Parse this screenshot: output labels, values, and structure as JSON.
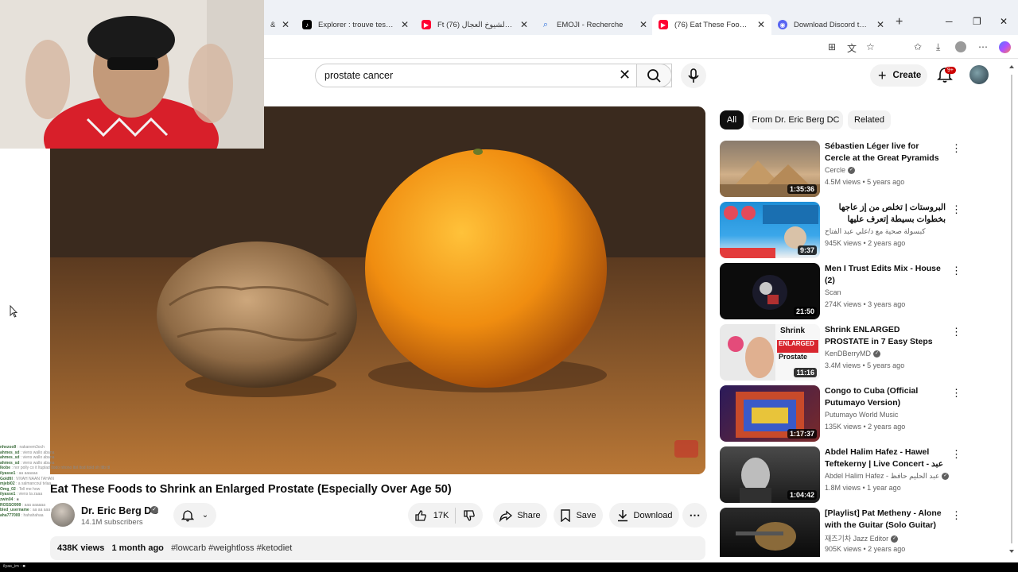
{
  "browser": {
    "tabs": [
      {
        "title": "& Sp",
        "icon": "partial-tab-icon",
        "color": "#888888"
      },
      {
        "title": "Explorer : trouve tes vidéo",
        "icon": "tiktok-icon",
        "color": "#000000"
      },
      {
        "title": "Ft شرح الشيوخ العجال (76)",
        "icon": "youtube-icon",
        "color": "#ff0033"
      },
      {
        "title": "EMOJI - Recherche",
        "icon": "search-icon",
        "color": "#2a6fdb"
      },
      {
        "title": "(76) Eat These Foods to Sh",
        "icon": "youtube-icon",
        "color": "#ff0033"
      },
      {
        "title": "Download Discord to Talk",
        "icon": "discord-icon",
        "color": "#5865f2"
      }
    ],
    "new_tab": "+"
  },
  "header": {
    "search_value": "prostate cancer",
    "create_label": "Create",
    "notifications_count": "9+"
  },
  "video": {
    "title": "Eat These Foods to Shrink an Enlarged Prostate (Especially Over Age 50)",
    "channel": "Dr. Eric Berg DC",
    "subscribers": "14.1M subscribers",
    "likes": "17K",
    "share_label": "Share",
    "save_label": "Save",
    "download_label": "Download",
    "views": "438K views",
    "uploaded": "1 month ago",
    "tags": "#lowcarb #weightloss #ketodiet"
  },
  "chips": [
    "All",
    "From Dr. Eric Berg DC",
    "Related"
  ],
  "recommendations": [
    {
      "title": "Sébastien Léger live for Cercle at the Great Pyramids of Giza, ...",
      "channel": "Cercle",
      "verified": true,
      "meta": "4.5M views • 5 years ago",
      "duration": "1:35:36",
      "thumb": "pyramids"
    },
    {
      "title": "البروستات | تخلص من إز عاجها بخطوات بسيطة إتعرف عليها #prostatitis#",
      "channel": "كبسولة صحية مع د/علي عبد الفتاح",
      "verified": false,
      "meta": "945K views • 2 years ago",
      "duration": "9:37",
      "thumb": "arabic"
    },
    {
      "title": "Men I Trust Edits Mix - House (2)",
      "channel": "Scan",
      "verified": false,
      "meta": "274K views • 3 years ago",
      "duration": "21:50",
      "thumb": "dark"
    },
    {
      "title": "Shrink ENLARGED PROSTATE in 7 Easy Steps (2024 Update)",
      "channel": "KenDBerryMD",
      "verified": true,
      "meta": "3.4M views • 5 years ago",
      "duration": "11:16",
      "thumb": "shrink"
    },
    {
      "title": "Congo to Cuba (Official Putumayo Version)",
      "channel": "Putumayo World Music",
      "verified": false,
      "meta": "135K views • 2 years ago",
      "duration": "1:17:37",
      "thumb": "congo"
    },
    {
      "title": "Abdel Halim Hafez - Hawel Teftekerny | Live Concert - عبد ...",
      "channel": "Abdel Halim Hafez - عبد الحليم حافظ",
      "verified": true,
      "meta": "1.8M views • 1 year ago",
      "duration": "1:04:42",
      "thumb": "bw"
    },
    {
      "title": "[Playlist] Pat Metheny - Alone with the Guitar (Solo Guitar)",
      "channel": "재즈기차 Jazz Editor",
      "verified": true,
      "meta": "905K views • 2 years ago",
      "duration": "1:00:12",
      "thumb": "guitar"
    }
  ],
  "chat": [
    {
      "user": "nhezoo9",
      "msg": "nakanem3och"
    },
    {
      "user": "ahmes_sd",
      "msg": "viens wallo abana"
    },
    {
      "user": "ahmes_sd",
      "msg": "viens wallo abana"
    },
    {
      "user": "ahmes_sd",
      "msg": "viens wallo abana"
    },
    {
      "user": "lkobe",
      "msg": "nor polly co it ltuplad tlodo nhono ltol ltod ltold oh ltlb ttl"
    },
    {
      "user": "ilyasse1",
      "msg": "aa aaaaaa"
    },
    {
      "user": "Goldfil",
      "msg": "VIVAH NAAN TAHAN"
    },
    {
      "user": "mjebi02",
      "msg": "a salmancoul tvlaa"
    },
    {
      "user": "Omg_02",
      "msg": "Tell me how"
    },
    {
      "user": "ilyasse1",
      "msg": "viens ta zaaa"
    },
    {
      "user": "zwin04",
      "msg": "■"
    },
    {
      "user": "ROSSO999",
      "msg": "aaa aaaaaa"
    },
    {
      "user": "bled_username",
      "msg": "aa aa aaa aaa aaa"
    },
    {
      "user": "aha777000",
      "msg": "hahahahaa"
    }
  ],
  "taskbar_text": "ilyas_im : ■"
}
